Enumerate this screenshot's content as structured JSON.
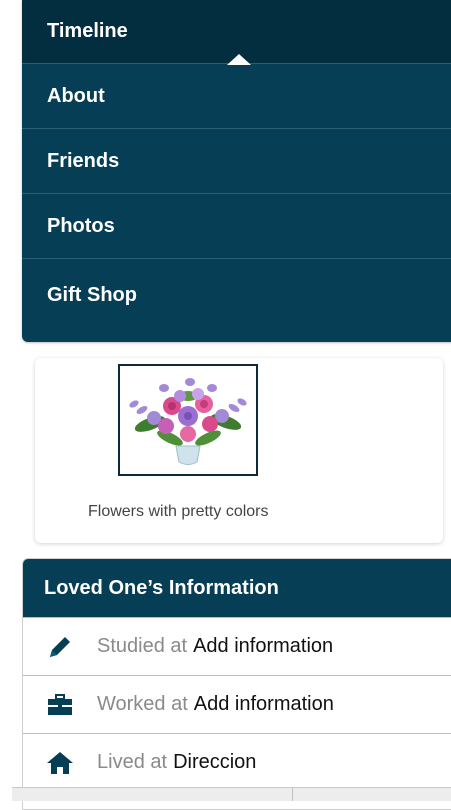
{
  "menu": {
    "items": [
      {
        "label": "Timeline"
      },
      {
        "label": "About"
      },
      {
        "label": "Friends"
      },
      {
        "label": "Photos"
      },
      {
        "label": "Gift Shop"
      }
    ]
  },
  "gift": {
    "caption": "Flowers with pretty colors"
  },
  "info": {
    "title": "Loved One’s Information",
    "rows": [
      {
        "icon": "pencil-icon",
        "prefix": "Studied at",
        "value": "Add information"
      },
      {
        "icon": "briefcase-icon",
        "prefix": "Worked at",
        "value": "Add information"
      },
      {
        "icon": "home-icon",
        "prefix": "Lived at",
        "value": "Direccion"
      }
    ]
  },
  "colors": {
    "menu_bg": "#053e55",
    "menu_active_bg": "#032e40",
    "icon": "#053e55"
  }
}
